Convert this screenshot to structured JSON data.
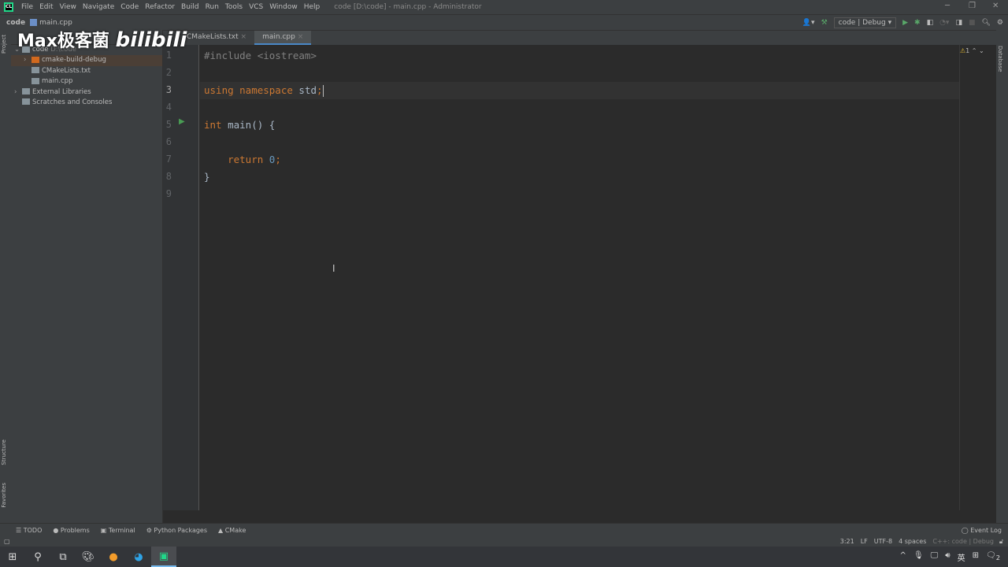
{
  "titlebar": {
    "app_icon": "CL",
    "menus": [
      "File",
      "Edit",
      "View",
      "Navigate",
      "Code",
      "Refactor",
      "Build",
      "Run",
      "Tools",
      "VCS",
      "Window",
      "Help"
    ],
    "window_title": "code [D:\\code] - main.cpp - Administrator"
  },
  "navbar": {
    "project": "code",
    "file": "main.cpp",
    "run_config": "code | Debug"
  },
  "tabs": [
    {
      "label": "CMakeLists.txt",
      "active": false
    },
    {
      "label": "main.cpp",
      "active": true
    }
  ],
  "left_strip": {
    "project": "Project",
    "structure": "Structure",
    "favorites": "Favorites"
  },
  "right_strip": {
    "database": "Database"
  },
  "project_tree": [
    {
      "label": "code",
      "path": "D:\\code",
      "type": "folder",
      "expanded": true,
      "depth": 0
    },
    {
      "label": "cmake-build-debug",
      "type": "folder-orange",
      "expanded": false,
      "depth": 1,
      "selected": true
    },
    {
      "label": "CMakeLists.txt",
      "type": "cmake",
      "depth": 1
    },
    {
      "label": "main.cpp",
      "type": "cpp",
      "depth": 1
    },
    {
      "label": "External Libraries",
      "type": "library",
      "expanded": false,
      "depth": 0
    },
    {
      "label": "Scratches and Consoles",
      "type": "scratch",
      "depth": 0
    }
  ],
  "editor": {
    "lines": [
      {
        "n": "1",
        "html": "<span class=\"pp\">#include &lt;iostream&gt;</span>"
      },
      {
        "n": "2",
        "html": ""
      },
      {
        "n": "3",
        "html": "<span class=\"kw\">using namespace</span> std<span class=\"kw\">;</span><span class=\"caret\"></span>"
      },
      {
        "n": "4",
        "html": ""
      },
      {
        "n": "5",
        "html": "<span class=\"kw\">int</span> main() {"
      },
      {
        "n": "6",
        "html": ""
      },
      {
        "n": "7",
        "html": "    <span class=\"kw\">return</span> <span class=\"num\">0</span><span class=\"kw\">;</span>"
      },
      {
        "n": "8",
        "html": "}"
      },
      {
        "n": "9",
        "html": ""
      }
    ],
    "current_line": 3,
    "warnings": "1"
  },
  "bottom_tools": [
    "TODO",
    "Problems",
    "Terminal",
    "Python Packages",
    "CMake"
  ],
  "event_log": "Event Log",
  "status": {
    "position": "3:21",
    "line_sep": "LF",
    "encoding": "UTF-8",
    "indent": "4 spaces",
    "context": "C++: code | Debug"
  },
  "taskbar": {
    "ime": "英",
    "notifications": "2"
  },
  "watermark": "Max极客菌 bilibili"
}
